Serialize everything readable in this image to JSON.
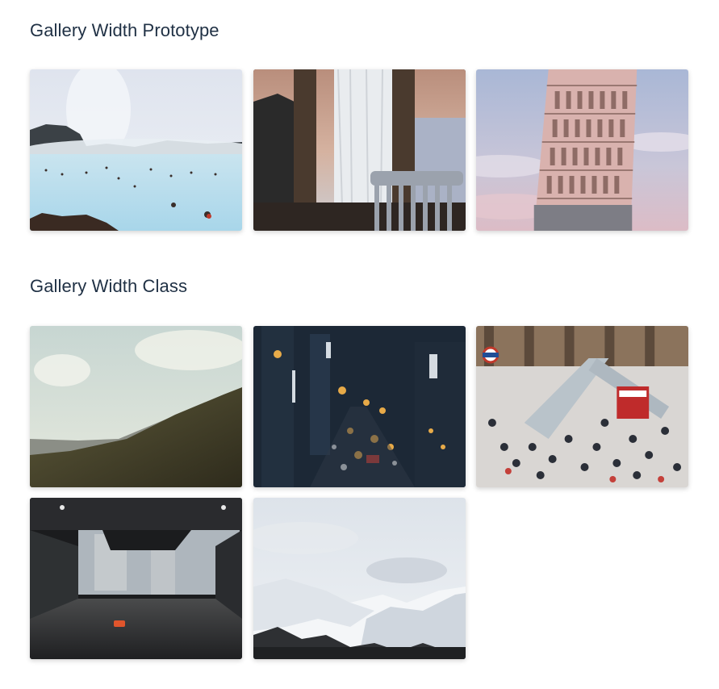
{
  "gallery_prototype": {
    "title": "Gallery Width Prototype",
    "images": [
      {
        "subject": "blue-lagoon-photo"
      },
      {
        "subject": "window-chair-photo"
      },
      {
        "subject": "leaning-tower-photo"
      }
    ]
  },
  "gallery_class": {
    "title": "Gallery Width Class",
    "images": [
      {
        "subject": "hillside-photo"
      },
      {
        "subject": "city-night-traffic-photo"
      },
      {
        "subject": "station-crowd-photo"
      },
      {
        "subject": "parking-garage-photo"
      },
      {
        "subject": "snowy-mountains-photo"
      }
    ]
  },
  "colors": {
    "heading": "#1f3044",
    "background": "#ffffff"
  }
}
